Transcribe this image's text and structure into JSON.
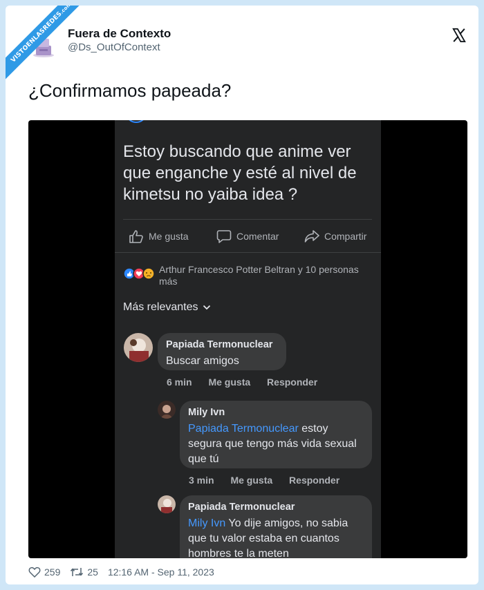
{
  "watermark": {
    "text": "VISTOENLASREDES",
    "sub": ".com"
  },
  "author": {
    "name": "Fuera de Contexto",
    "handle": "@Ds_OutOfContext"
  },
  "tweet": {
    "text": "¿Confirmamos papeada?"
  },
  "embedded_post": {
    "body": "Estoy buscando que anime ver que enganche y esté al nivel de kimetsu no yaiba idea ?",
    "actions": {
      "like": "Me gusta",
      "comment": "Comentar",
      "share": "Compartir"
    },
    "reactions_text": "Arthur Francesco Potter Beltran y 10 personas más",
    "sort_label": "Más relevantes",
    "comments": [
      {
        "name": "Papiada Termonuclear",
        "mention": "",
        "text": "Buscar amigos",
        "time": "6 min",
        "like": "Me gusta",
        "reply": "Responder"
      },
      {
        "name": "Mily Ivn",
        "mention": "Papiada Termonuclear",
        "text": " estoy segura que tengo más vida sexual que tú",
        "time": "3 min",
        "like": "Me gusta",
        "reply": "Responder"
      },
      {
        "name": "Papiada Termonuclear",
        "mention": "Mily Ivn",
        "text": " Yo dije amigos, no sabia que tu valor estaba en cuantos hombres te la meten"
      }
    ]
  },
  "stats": {
    "likes": "259",
    "retweets": "25",
    "timestamp": "12:16 AM - Sep 11, 2023"
  },
  "icons": {
    "like": "heart-icon",
    "retweet": "retweet-icon",
    "close": "x-logo-icon"
  },
  "colors": {
    "background": "#cfe6f7",
    "ribbon": "#2f9ae6",
    "fb_dark": "#242526",
    "mention": "#4599ff"
  }
}
